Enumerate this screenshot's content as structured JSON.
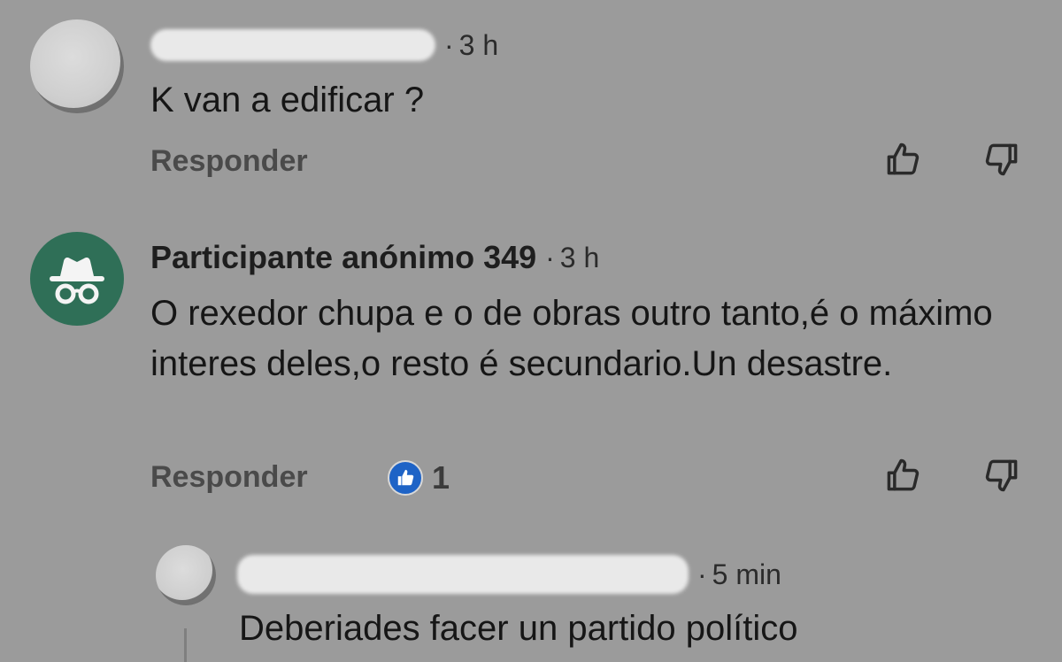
{
  "comments": [
    {
      "time": "3 h",
      "text": "K van a edificar ?",
      "reply_label": "Responder"
    },
    {
      "author": "Participante anónimo 349",
      "time": "3 h",
      "text": "O rexedor chupa e o de obras outro tanto,é o máximo interes deles,o resto é secundario.Un desastre.",
      "reply_label": "Responder",
      "like_count": "1"
    },
    {
      "time": "5 min",
      "text": "Deberiades facer un partido político"
    }
  ],
  "colors": {
    "background": "#9b9b9b",
    "anon_avatar": "#2f6f57",
    "like_badge": "#1e63c6"
  },
  "icons": {
    "like": "thumb-up-outline-icon",
    "dislike": "thumb-down-outline-icon",
    "anonymous": "incognito-hat-glasses-icon",
    "like_badge": "thumb-up-filled-icon"
  }
}
